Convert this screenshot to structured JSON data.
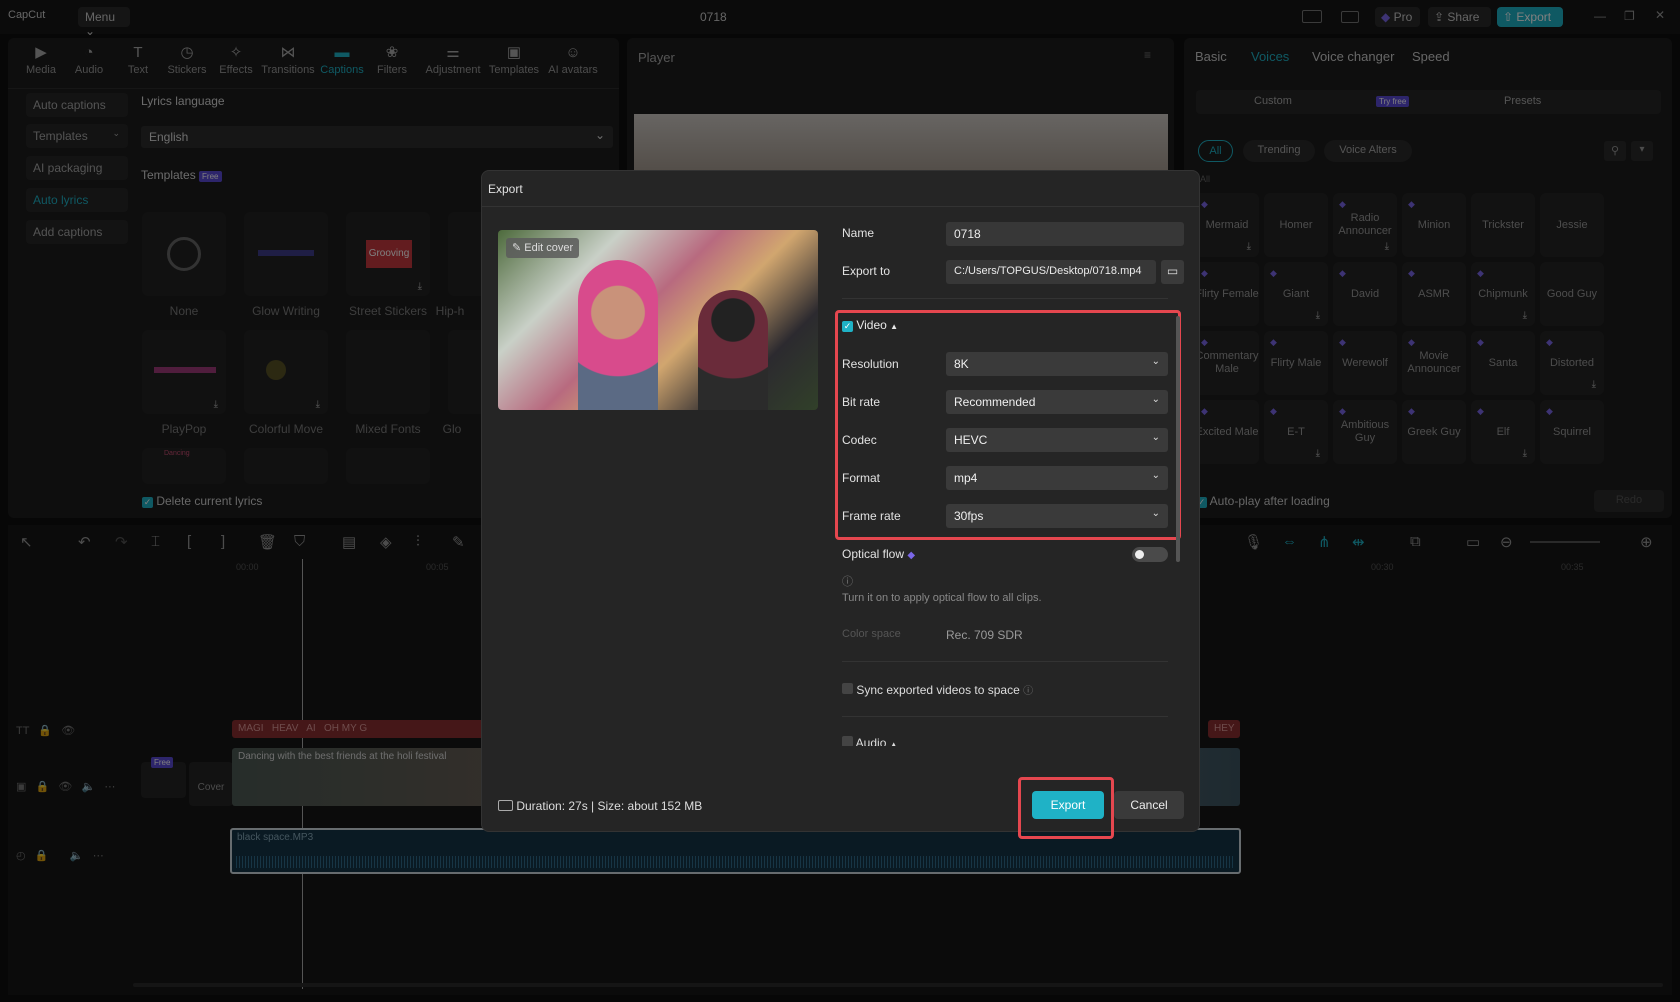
{
  "app": {
    "logo": "CapCut",
    "menu": "Menu",
    "title": "0718",
    "pro": "Pro",
    "share": "Share",
    "export": "Export"
  },
  "toolbar": [
    {
      "label": "Media",
      "icon": "media-icon"
    },
    {
      "label": "Audio",
      "icon": "audio-icon"
    },
    {
      "label": "Text",
      "icon": "text-icon"
    },
    {
      "label": "Stickers",
      "icon": "stickers-icon"
    },
    {
      "label": "Effects",
      "icon": "effects-icon"
    },
    {
      "label": "Transitions",
      "icon": "transitions-icon"
    },
    {
      "label": "Captions",
      "icon": "captions-icon"
    },
    {
      "label": "Filters",
      "icon": "filters-icon"
    },
    {
      "label": "Adjustment",
      "icon": "adjustment-icon"
    },
    {
      "label": "Templates",
      "icon": "templates-icon"
    },
    {
      "label": "AI avatars",
      "icon": "ai-avatars-icon"
    }
  ],
  "captions_sidebar": [
    "Auto captions",
    "Templates",
    "AI packaging",
    "Auto lyrics",
    "Add captions"
  ],
  "lyrics": {
    "language_label": "Lyrics language",
    "language_value": "English",
    "templates_label": "Templates",
    "free_badge": "Free",
    "delete_label": "Delete current lyrics"
  },
  "templates": [
    "None",
    "Glow Writing",
    "Street Stickers",
    "Hip-h",
    "PlayPop",
    "Colorful Move",
    "Mixed Fonts",
    "Glo"
  ],
  "template_texts": {
    "grooving": "Grooving",
    "dancing": "Dancing"
  },
  "player": {
    "title": "Player"
  },
  "right_tabs": [
    "Basic",
    "Voices",
    "Voice changer",
    "Speed"
  ],
  "voice_subtabs": {
    "custom": "Custom",
    "try_free": "Try free",
    "presets": "Presets"
  },
  "voice_filters": [
    "All",
    "Trending",
    "Voice Alters"
  ],
  "voice_all_label": "All",
  "voices": [
    "Mermaid",
    "Homer",
    "Radio Announcer",
    "Minion",
    "Trickster",
    "Jessie",
    "Flirty Female",
    "Giant",
    "David",
    "ASMR",
    "Chipmunk",
    "Good Guy",
    "Commentary Male",
    "Flirty Male",
    "Werewolf",
    "Movie Announcer",
    "Santa",
    "Distorted",
    "Excited Male",
    "E-T",
    "Ambitious Guy",
    "Greek Guy",
    "Elf",
    "Squirrel"
  ],
  "autoplay": {
    "label": "Auto-play after loading",
    "done": "Redo"
  },
  "timeline": {
    "marks": [
      "00:00",
      "00:05",
      "00:30",
      "00:35"
    ],
    "caption_chips": [
      "MAGI",
      "HEAV",
      "AI",
      "OH MY G",
      "HEY"
    ],
    "video_clip": "Dancing with the best friends at the holi festival",
    "audio_clip": "black space.MP3",
    "cover": "Cover",
    "free": "Free"
  },
  "export_dialog": {
    "title": "Export",
    "edit_cover": "Edit cover",
    "name_label": "Name",
    "name_value": "0718",
    "export_to_label": "Export to",
    "export_to_value": "C:/Users/TOPGUS/Desktop/0718.mp4",
    "video_label": "Video",
    "resolution_label": "Resolution",
    "resolution_value": "8K",
    "bitrate_label": "Bit rate",
    "bitrate_value": "Recommended",
    "codec_label": "Codec",
    "codec_value": "HEVC",
    "format_label": "Format",
    "format_value": "mp4",
    "framerate_label": "Frame rate",
    "framerate_value": "30fps",
    "optical_flow_label": "Optical flow",
    "optical_flow_on": false,
    "optical_flow_hint": "Turn it on to apply optical flow to all clips.",
    "color_space_label": "Color space",
    "color_space_value": "Rec. 709 SDR",
    "sync_label": "Sync exported videos to space",
    "audio_label": "Audio",
    "summary": "Duration: 27s | Size: about 152 MB",
    "export_btn": "Export",
    "cancel_btn": "Cancel"
  },
  "colors": {
    "accent": "#1fb2c6",
    "highlight": "#e5474f",
    "gem": "#7b67e8"
  }
}
